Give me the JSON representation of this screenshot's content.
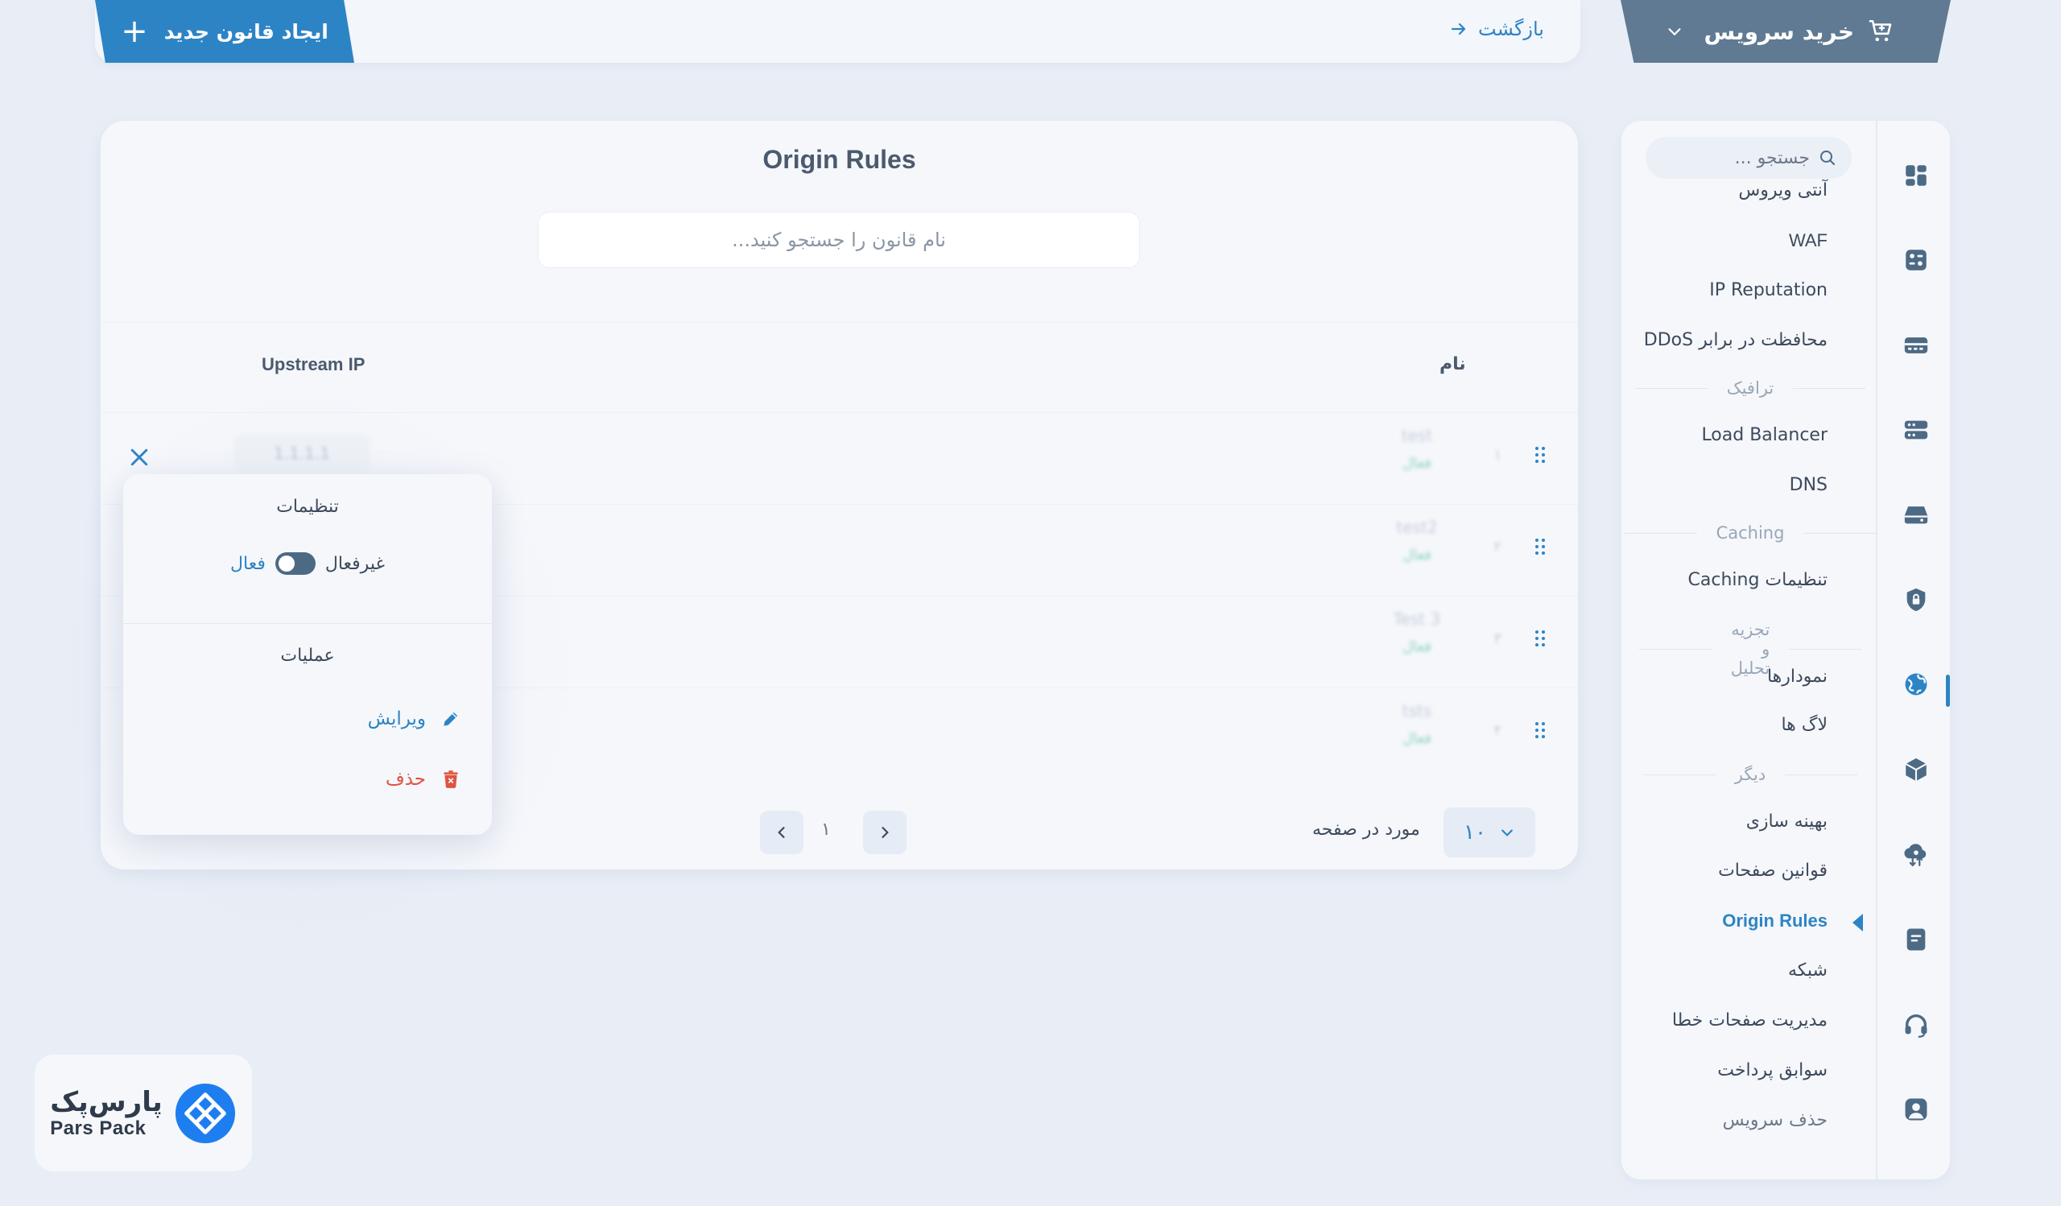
{
  "header": {
    "create_label": "ایجاد قانون جدید",
    "back_label": "بازگشت",
    "buy_label": "خرید سرویس"
  },
  "sidebar": {
    "search_placeholder": "جستجو ...",
    "items": [
      {
        "label": "آنتی ویروس"
      },
      {
        "label": "WAF"
      },
      {
        "label": "IP Reputation"
      },
      {
        "label": "محافظت در برابر DDoS"
      },
      {
        "section": "ترافیک"
      },
      {
        "label": "Load Balancer"
      },
      {
        "label": "DNS"
      },
      {
        "section": "Caching"
      },
      {
        "label": "تنظیمات Caching"
      },
      {
        "section": "تجزیه و تحلیل"
      },
      {
        "label": "نمودارها"
      },
      {
        "label": "لاگ ها"
      },
      {
        "section": "دیگر"
      },
      {
        "label": "بهینه سازی"
      },
      {
        "label": "قوانین صفحات"
      },
      {
        "label": "Origin Rules",
        "active": true
      },
      {
        "label": "شبکه"
      },
      {
        "label": "مدیریت صفحات خطا"
      },
      {
        "label": "سوابق پرداخت"
      },
      {
        "label": "حذف سرویس"
      }
    ]
  },
  "main": {
    "title": "Origin Rules",
    "search_placeholder": "نام قانون را جستجو کنید...",
    "columns": {
      "name": "نام",
      "upstream": "Upstream IP"
    },
    "rows": [
      {
        "index": "۱",
        "name": "test",
        "status": "فعال",
        "upstream": "1.1.1.1"
      },
      {
        "index": "۲",
        "name": "test2",
        "status": "فعال",
        "upstream": ""
      },
      {
        "index": "۳",
        "name": "Test 3",
        "status": "فعال",
        "upstream": ""
      },
      {
        "index": "۴",
        "name": "tsts",
        "status": "فعال",
        "upstream": ""
      }
    ],
    "pagination": {
      "per_page_value": "۱۰",
      "per_page_label": "مورد در صفحه",
      "current_page": "۱"
    }
  },
  "popover": {
    "settings_title": "تنظیمات",
    "toggle_off_label": "غیرفعال",
    "toggle_on_label": "فعال",
    "toggle_state": "on",
    "operations_title": "عملیات",
    "edit_label": "ویرایش",
    "delete_label": "حذف"
  },
  "logo": {
    "fa": "پارس‌پک",
    "en": "Pars Pack"
  },
  "colors": {
    "accent": "#2d84c5",
    "buy_button": "#5f7a92",
    "danger": "#e0533f",
    "background": "#e9eef6",
    "panel": "#f5f7fb"
  },
  "icons": {
    "rail": [
      "dashboard-icon",
      "widgets-icon",
      "server-icon",
      "database-icon",
      "storage-icon",
      "shield-icon",
      "cdn-globe-icon",
      "box-icon",
      "cloud-icon",
      "document-icon",
      "headset-icon",
      "user-icon"
    ]
  }
}
